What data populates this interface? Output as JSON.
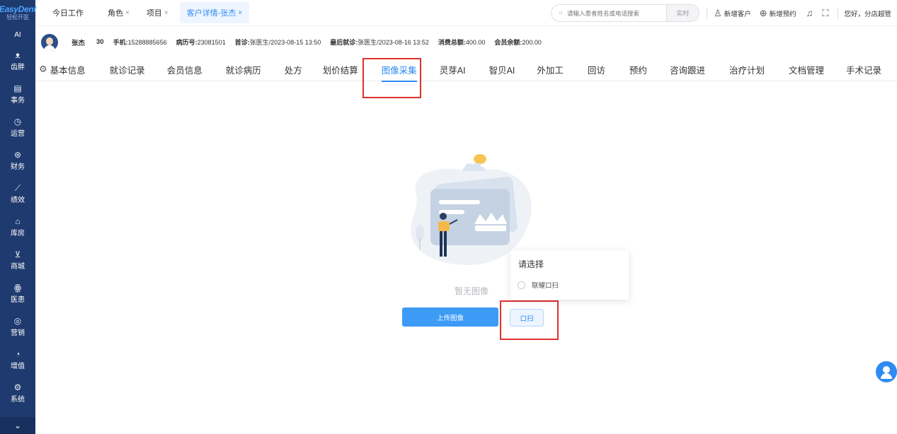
{
  "sidebar": {
    "logo_main": "EasyDent",
    "logo_sub": "轻松开医",
    "ai_label": "AI",
    "items": [
      {
        "icon": "tooth-icon",
        "glyph": "ᴥ",
        "label": "齿胖"
      },
      {
        "icon": "document-icon",
        "glyph": "▤",
        "label": "事务"
      },
      {
        "icon": "clock-icon",
        "glyph": "◷",
        "label": "运营"
      },
      {
        "icon": "wallet-icon",
        "glyph": "⊛",
        "label": "财务"
      },
      {
        "icon": "chart-icon",
        "glyph": "⟋",
        "label": "绩效"
      },
      {
        "icon": "warehouse-icon",
        "glyph": "⌂",
        "label": "库房"
      },
      {
        "icon": "cart-icon",
        "glyph": "⊻",
        "label": "商城"
      },
      {
        "icon": "users-icon",
        "glyph": "ꙮ",
        "label": "医患"
      },
      {
        "icon": "target-icon",
        "glyph": "◎",
        "label": "营销"
      },
      {
        "icon": "growth-icon",
        "glyph": "◔",
        "label": "增值"
      },
      {
        "icon": "gear-icon",
        "glyph": "⚙",
        "label": "系统"
      }
    ],
    "collapse_glyph": "⌄"
  },
  "topbar": {
    "tabs": [
      {
        "label": "今日工作",
        "closable": false
      },
      {
        "label": "角色",
        "closable": true
      },
      {
        "label": "项目",
        "closable": true
      },
      {
        "label": "客户详情-张杰",
        "closable": true,
        "active": true
      }
    ],
    "close_glyph": "×",
    "search_placeholder": "请输入患者姓名或电话搜索",
    "search_button": "实时",
    "new_customer": "新增客户",
    "new_appointment": "新增预约",
    "greeting": "您好，分店超管"
  },
  "patient": {
    "name": "张杰",
    "age": "30",
    "phone_label": "手机:",
    "phone": "15288885656",
    "record_label": "病历号:",
    "record": "23081501",
    "first_label": "首诊:",
    "first": "张医生/2023-08-15 13:50",
    "last_label": "最后就诊:",
    "last": "张医生/2023-08-16 13:52",
    "spent_label": "消费总额:",
    "spent": "400.00",
    "balance_label": "会员余额:",
    "balance": "200.00"
  },
  "nav": {
    "items": [
      "基本信息",
      "就诊记录",
      "会员信息",
      "就诊病历",
      "处方",
      "划价结算",
      "图像采集",
      "灵芽AI",
      "智贝AI",
      "外加工",
      "回访",
      "预约",
      "咨询跟进",
      "治疗计划",
      "文档管理",
      "手术记录"
    ],
    "active_index": 6
  },
  "content": {
    "empty_text": "暂无图像",
    "upload_button": "上传图像",
    "scan_button": "口扫",
    "popup_title": "请选择",
    "popup_option": "联耀口扫"
  },
  "colors": {
    "sidebar_bg": "#1f3a6e",
    "accent": "#2e8bf2",
    "highlight": "#e0302d"
  }
}
